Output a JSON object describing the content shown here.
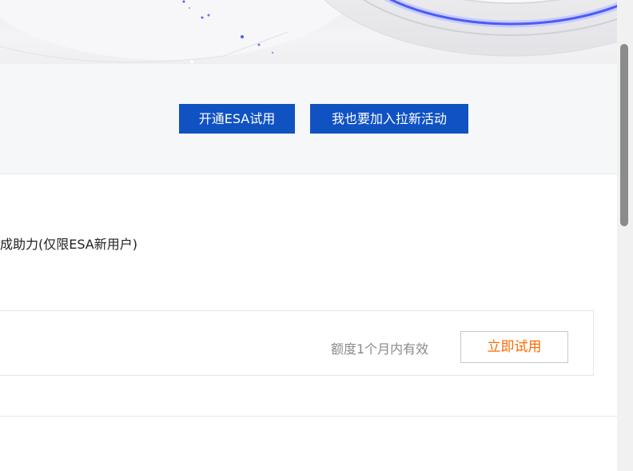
{
  "hero": {
    "icon": "hero-3d-ring-artwork"
  },
  "actions": {
    "trial_label": "开通ESA试用",
    "join_label": "我也要加入拉新活动"
  },
  "section": {
    "title": "成助力(仅限ESA新用户)"
  },
  "offer": {
    "validity": "额度1个月内有效",
    "try_label": "立即试用"
  },
  "colors": {
    "primary": "#1052c2",
    "accent": "#ff6a00",
    "band_bg": "#f6f7f9"
  }
}
